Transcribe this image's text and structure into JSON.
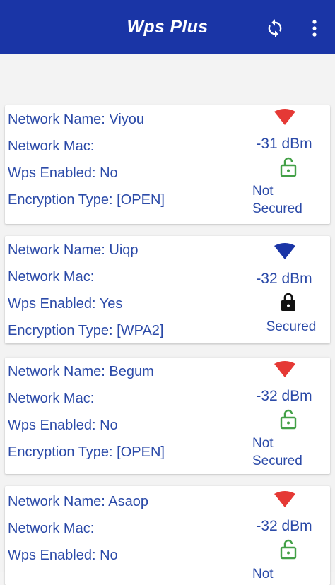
{
  "app": {
    "title": "Wps Plus",
    "colors": {
      "appbar": "#1a35a6",
      "text": "#2b4aa8",
      "signal_weak": "#e53935",
      "signal_strong": "#1a35a6",
      "lock_open": "#43a047",
      "lock_closed": "#111111"
    }
  },
  "toolbar": {
    "refresh_icon": "refresh-icon",
    "menu_icon": "more-vert-icon"
  },
  "networks": [
    {
      "name_line": "Network Name: Viyou",
      "mac_line": "Network Mac:",
      "wps_line": "Wps Enabled: No",
      "enc_line": "Encryption Type: [OPEN]",
      "signal": "-31 dBm",
      "signal_color": "#e53935",
      "lock": "lock-open-icon",
      "status_l1": "Not",
      "status_l2": "Secured"
    },
    {
      "name_line": "Network Name: Uiqp",
      "mac_line": "Network Mac:",
      "wps_line": "Wps Enabled: Yes",
      "enc_line": "Encryption Type: [WPA2]",
      "signal": "-32 dBm",
      "signal_color": "#1a35a6",
      "lock": "lock-closed-icon",
      "status_l1": "Secured"
    },
    {
      "name_line": "Network Name: Begum",
      "mac_line": "Network Mac:",
      "wps_line": "Wps Enabled: No",
      "enc_line": "Encryption Type: [OPEN]",
      "signal": "-32 dBm",
      "signal_color": "#e53935",
      "lock": "lock-open-icon",
      "status_l1": "Not",
      "status_l2": "Secured"
    },
    {
      "name_line": "Network Name: Asaop",
      "mac_line": "Network Mac:",
      "wps_line": "Wps Enabled: No",
      "signal": "-32 dBm",
      "signal_color": "#e53935",
      "lock": "lock-open-icon",
      "status_l1": "Not"
    }
  ]
}
